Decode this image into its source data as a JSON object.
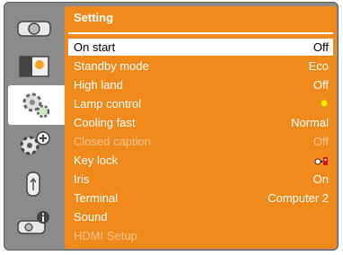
{
  "panel": {
    "title": "Setting"
  },
  "sidebar": {
    "items": [
      {
        "icon": "projector-icon"
      },
      {
        "icon": "picture-adjust-icon"
      },
      {
        "icon": "settings-gear-icon"
      },
      {
        "icon": "expanded-settings-icon"
      },
      {
        "icon": "usb-memory-icon"
      },
      {
        "icon": "information-icon"
      }
    ]
  },
  "menu": {
    "rows": [
      {
        "label": "On start",
        "value": "Off"
      },
      {
        "label": "Standby mode",
        "value": "Eco"
      },
      {
        "label": "High land",
        "value": "Off"
      },
      {
        "label": "Lamp control",
        "value": "",
        "value_icon": "lamp-bulb-icon"
      },
      {
        "label": "Cooling fast",
        "value": "Normal"
      },
      {
        "label": "Closed caption",
        "value": "Off"
      },
      {
        "label": "Key lock",
        "value": "",
        "value_icon": "key-lock-icon"
      },
      {
        "label": "Iris",
        "value": "On"
      },
      {
        "label": "Terminal",
        "value": "Computer 2"
      },
      {
        "label": "Sound",
        "value": ""
      },
      {
        "label": "HDMI Setup",
        "value": ""
      }
    ]
  },
  "colors": {
    "accent": "#f08a1c",
    "frame": "#8b8b8b",
    "disabled_text": "#f7c48e"
  }
}
